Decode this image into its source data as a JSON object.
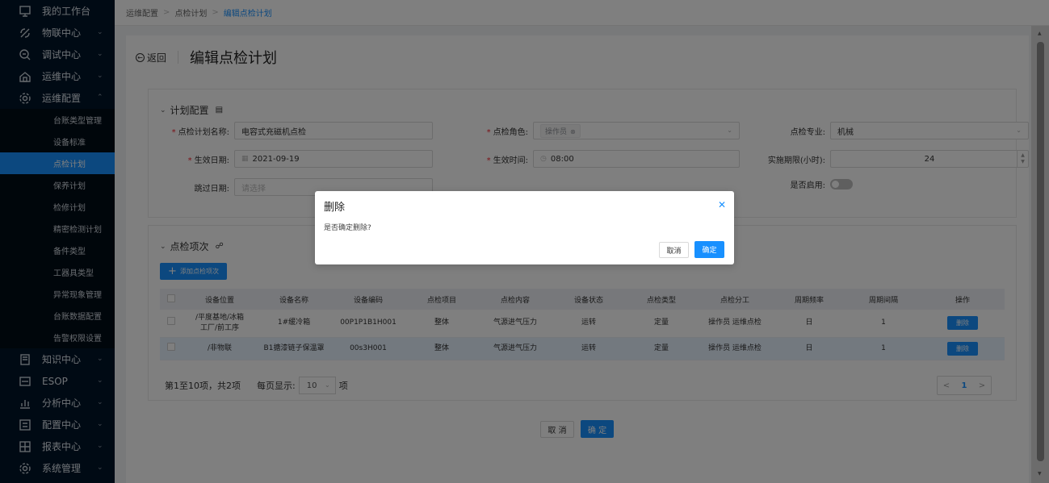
{
  "sidebar": {
    "items": [
      {
        "label": "我的工作台",
        "icon": "workbench-icon",
        "chevron": false
      },
      {
        "label": "物联中心",
        "icon": "iot-icon",
        "chevron": true
      },
      {
        "label": "调试中心",
        "icon": "debug-icon",
        "chevron": true
      },
      {
        "label": "运维中心",
        "icon": "operation-icon",
        "chevron": true
      },
      {
        "label": "运维配置",
        "icon": "settings-gear-icon",
        "chevron": true,
        "expanded": true
      }
    ],
    "sub_items": [
      "台账类型管理",
      "设备标准",
      "点检计划",
      "保养计划",
      "检修计划",
      "精密检测计划",
      "备件类型",
      "工器具类型",
      "异常现象管理",
      "台账数据配置",
      "告警权限设置"
    ],
    "active_sub": "点检计划",
    "items_after": [
      {
        "label": "知识中心",
        "icon": "knowledge-icon"
      },
      {
        "label": "ESOP",
        "icon": "esop-icon"
      },
      {
        "label": "分析中心",
        "icon": "analysis-icon"
      },
      {
        "label": "配置中心",
        "icon": "config-icon"
      },
      {
        "label": "报表中心",
        "icon": "report-icon"
      },
      {
        "label": "系统管理",
        "icon": "system-gear-icon"
      }
    ]
  },
  "breadcrumb": [
    "运维配置",
    "点检计划",
    "编辑点检计划"
  ],
  "header": {
    "back_label": "返回",
    "title": "编辑点检计划"
  },
  "plan_config": {
    "title": "计划配置",
    "fields": {
      "plan_name_label": "点检计划名称:",
      "plan_name_value": "电容式充磁机点检",
      "role_label": "点检角色:",
      "role_tag": "操作员",
      "specialty_label": "点检专业:",
      "specialty_value": "机械",
      "effective_date_label": "生效日期:",
      "effective_date_value": "2021-09-19",
      "effective_time_label": "生效时间:",
      "effective_time_value": "08:00",
      "period_label": "实施期限(小时):",
      "period_value": "24",
      "skip_date_label": "跳过日期:",
      "skip_date_placeholder": "请选择",
      "enabled_label": "是否启用:"
    }
  },
  "items_section": {
    "title": "点检项次",
    "add_button": "添加点检项次",
    "columns": [
      "设备位置",
      "设备名称",
      "设备编码",
      "点检项目",
      "点检内容",
      "设备状态",
      "点检类型",
      "点检分工",
      "周期频率",
      "周期间隔",
      "操作"
    ],
    "rows": [
      {
        "location": "/平度基地/冰箱工厂/前工序",
        "name": "1#缓冷箱",
        "code": "00P1P1B1H001",
        "item": "整体",
        "content": "气源进气压力",
        "status": "运转",
        "type": "定量",
        "division": "操作员 运维点检",
        "frequency": "日",
        "interval": "1",
        "action": "删除"
      },
      {
        "location": "/非物联",
        "name": "B1搪漆链子保温罩",
        "code": "00s3H001",
        "item": "整体",
        "content": "气源进气压力",
        "status": "运转",
        "type": "定量",
        "division": "操作员 运维点检",
        "frequency": "日",
        "interval": "1",
        "action": "删除"
      }
    ],
    "pager": {
      "summary": "第1至10项，共2项",
      "per_page_label": "每页显示:",
      "per_page_value": "10",
      "unit": "项",
      "current_page": "1"
    }
  },
  "footer": {
    "cancel": "取 消",
    "ok": "确 定"
  },
  "modal": {
    "title": "删除",
    "message": "是否确定删除?",
    "cancel": "取消",
    "ok": "确定"
  },
  "colors": {
    "primary": "#1890ff",
    "sidebar_bg": "#001529"
  }
}
